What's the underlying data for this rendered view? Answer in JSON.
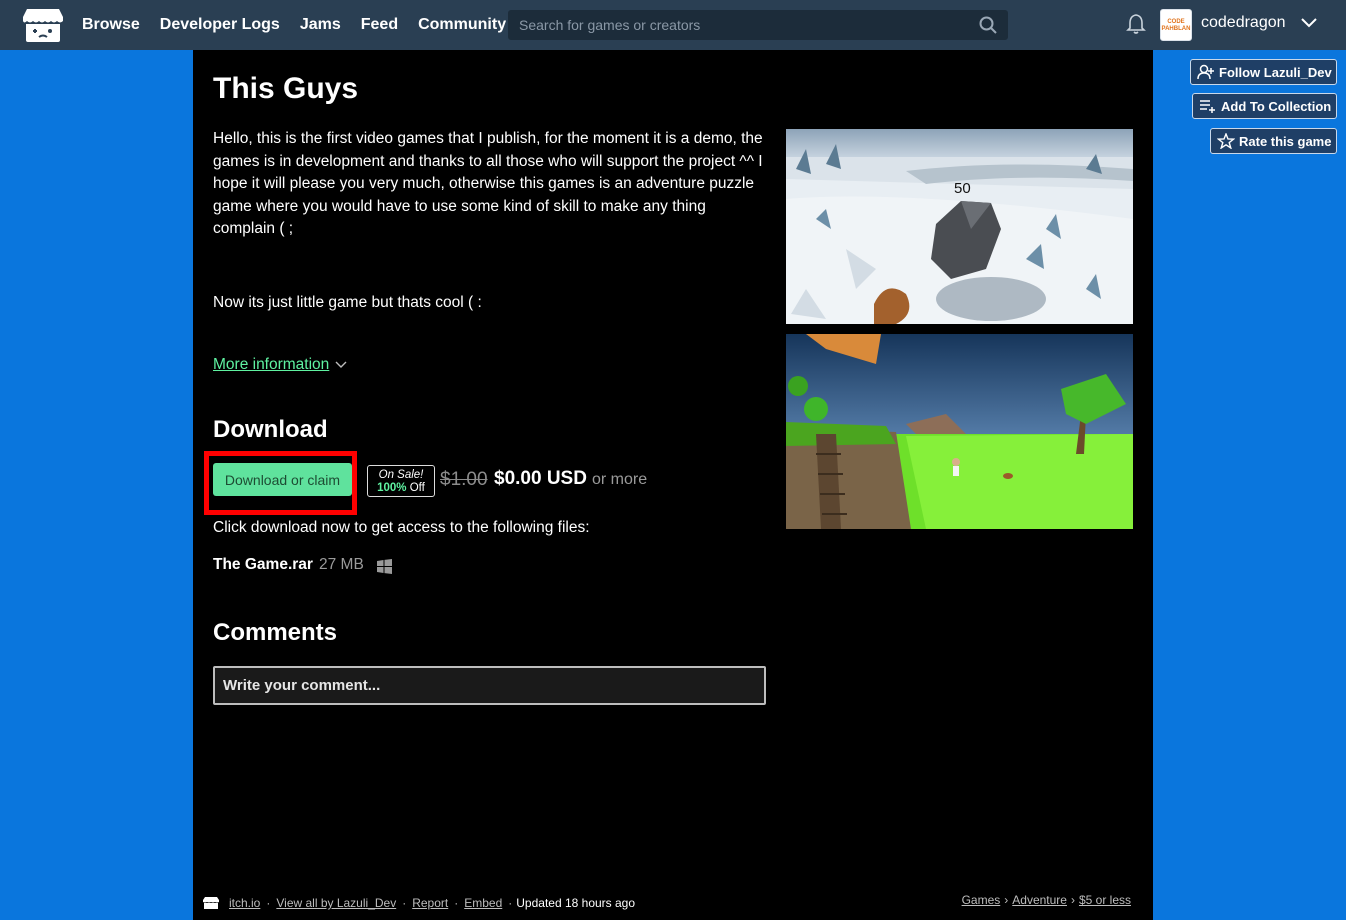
{
  "header": {
    "nav": [
      "Browse",
      "Developer Logs",
      "Jams",
      "Feed",
      "Community"
    ],
    "search_placeholder": "Search for games or creators",
    "username": "codedragon",
    "avatar_text": "CODE PAHBLAN"
  },
  "game": {
    "title": "This Guys",
    "description": "Hello, this is the first video games that I publish, for the moment it is a demo, the games is in development and thanks to all those who will support the project ^^ I hope it will please you very much, otherwise this games is an adventure puzzle game where you would have to use some kind of skill to make any thing complain ( ;",
    "description2": "Now its just little game but thats cool ( :",
    "more_info": "More information"
  },
  "download": {
    "heading": "Download",
    "button": "Download or claim",
    "sale_label": "On Sale!",
    "sale_pct": "100%",
    "sale_off": "Off",
    "old_price": "$1.00",
    "new_price": "$0.00 USD",
    "or_more": "or more",
    "click_text": "Click download now to get access to the following files:",
    "file_name": "The Game.rar",
    "file_size": "27 MB"
  },
  "comments": {
    "heading": "Comments",
    "placeholder": "Write your comment..."
  },
  "screenshots": {
    "shot1_label": "50"
  },
  "footer": {
    "site": "itch.io",
    "view_all": "View all by Lazuli_Dev",
    "report": "Report",
    "embed": "Embed",
    "updated": "Updated 18 hours ago",
    "crumbs": [
      "Games",
      "Adventure",
      "$5 or less"
    ]
  },
  "side_buttons": {
    "follow": "Follow Lazuli_Dev",
    "collection": "Add To Collection",
    "rate": "Rate this game"
  },
  "colors": {
    "background": "#0a76dd",
    "topbar": "#2a3f53",
    "accent_green": "#5fe29d",
    "highlight_red": "#ff0000"
  }
}
